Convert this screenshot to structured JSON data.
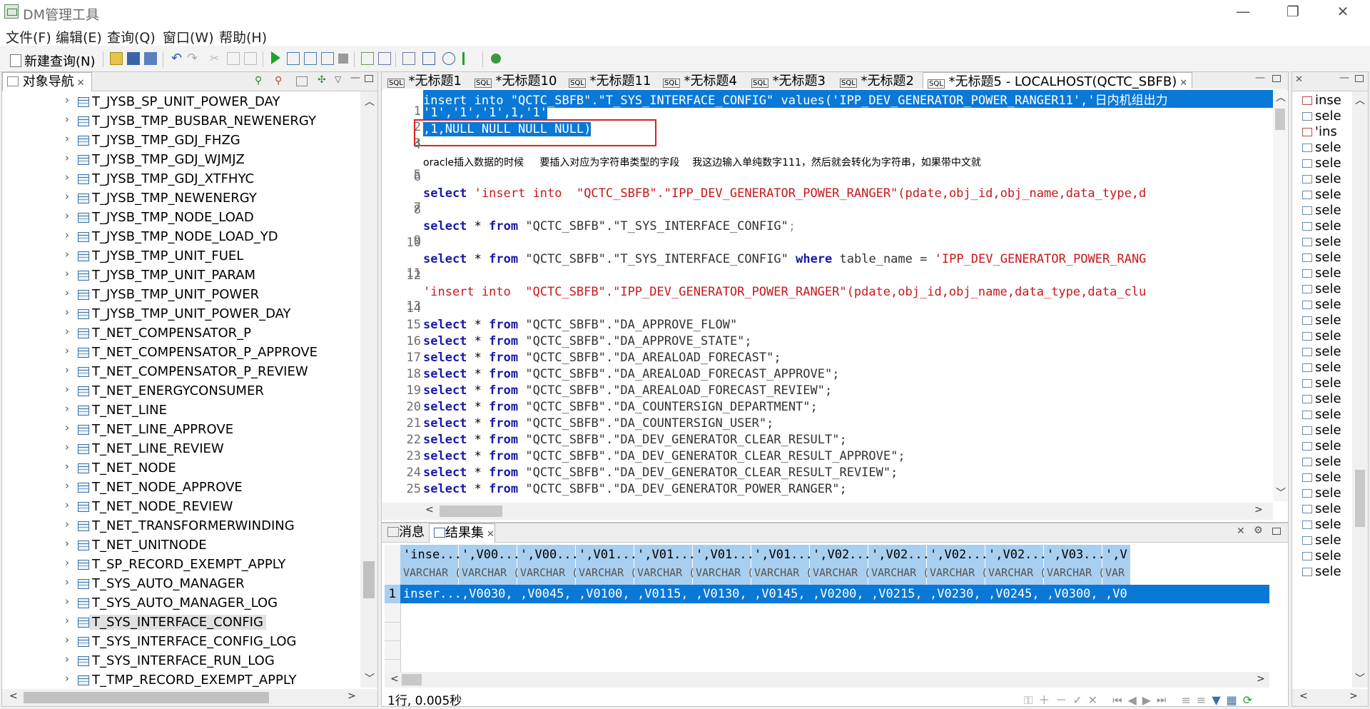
{
  "window": {
    "title": "DM管理工具",
    "minimize": "—",
    "restore": "❐",
    "close": "✕"
  },
  "menu": [
    "文件(F)",
    "编辑(E)",
    "查询(Q)",
    "窗口(W)",
    "帮助(H)"
  ],
  "toolbar": {
    "new_query": "新建查询(N)"
  },
  "navigator": {
    "title": "对象导航",
    "items": [
      "T_JYSB_SP_UNIT_POWER_DAY",
      "T_JYSB_TMP_BUSBAR_NEWENERGY",
      "T_JYSB_TMP_GDJ_FHZG",
      "T_JYSB_TMP_GDJ_WJMJZ",
      "T_JYSB_TMP_GDJ_XTFHYC",
      "T_JYSB_TMP_NEWENERGY",
      "T_JYSB_TMP_NODE_LOAD",
      "T_JYSB_TMP_NODE_LOAD_YD",
      "T_JYSB_TMP_UNIT_FUEL",
      "T_JYSB_TMP_UNIT_PARAM",
      "T_JYSB_TMP_UNIT_POWER",
      "T_JYSB_TMP_UNIT_POWER_DAY",
      "T_NET_COMPENSATOR_P",
      "T_NET_COMPENSATOR_P_APPROVE",
      "T_NET_COMPENSATOR_P_REVIEW",
      "T_NET_ENERGYCONSUMER",
      "T_NET_LINE",
      "T_NET_LINE_APPROVE",
      "T_NET_LINE_REVIEW",
      "T_NET_NODE",
      "T_NET_NODE_APPROVE",
      "T_NET_NODE_REVIEW",
      "T_NET_TRANSFORMERWINDING",
      "T_NET_UNITNODE",
      "T_SP_RECORD_EXEMPT_APPLY",
      "T_SYS_AUTO_MANAGER",
      "T_SYS_AUTO_MANAGER_LOG",
      "T_SYS_INTERFACE_CONFIG",
      "T_SYS_INTERFACE_CONFIG_LOG",
      "T_SYS_INTERFACE_RUN_LOG",
      "T_TMP_RECORD_EXEMPT_APPLY"
    ],
    "selected": "T_SYS_INTERFACE_CONFIG"
  },
  "editor_tabs": [
    "*无标题1",
    "*无标题10",
    "*无标题11",
    "*无标题4",
    "*无标题3",
    "*无标题2",
    "*无标题5 - LOCALHOST(QCTC_SBFB)"
  ],
  "active_editor_tab": "*无标题5 - LOCALHOST(QCTC_SBFB)",
  "code": {
    "line1": "insert into \"QCTC_SBFB\".\"T_SYS_INTERFACE_CONFIG\" values('IPP_DEV_GENERATOR_POWER_RANGER11','日内机组出力",
    "line2": "'1','1','1',1,'1'",
    "line3": ",1,NULL NULL NULL NULL)",
    "line5": "oracle插入数据的时候     要插入对应为字符串类型的字段    我这边输入单纯数字111，然后就会转化为字符串，如果带中文就",
    "line7_kw": "select",
    "line7_str": "'insert into  \"QCTC_SBFB\".\"IPP_DEV_GENERATOR_POWER_RANGER\"(pdate,obj_id,obj_name,data_type,d",
    "line9_tail": "\"QCTC_SBFB\".\"T_SYS_INTERFACE_CONFIG\"",
    "line11_mid": "\"QCTC_SBFB\".\"T_SYS_INTERFACE_CONFIG\"",
    "line11_where": "where",
    "line11_cond": "table_name =",
    "line11_str": "'IPP_DEV_GENERATOR_POWER_RANG",
    "line13": "'insert into  \"QCTC_SBFB\".\"IPP_DEV_GENERATOR_POWER_RANGER\"(pdate,obj_id,obj_name,data_type,data_clu",
    "select_tables": [
      "\"QCTC_SBFB\".\"DA_APPROVE_FLOW\"",
      "\"QCTC_SBFB\".\"DA_APPROVE_STATE\";",
      "\"QCTC_SBFB\".\"DA_AREALOAD_FORECAST\";",
      "\"QCTC_SBFB\".\"DA_AREALOAD_FORECAST_APPROVE\";",
      "\"QCTC_SBFB\".\"DA_AREALOAD_FORECAST_REVIEW\";",
      "\"QCTC_SBFB\".\"DA_COUNTERSIGN_DEPARTMENT\";",
      "\"QCTC_SBFB\".\"DA_COUNTERSIGN_USER\";",
      "\"QCTC_SBFB\".\"DA_DEV_GENERATOR_CLEAR_RESULT\";",
      "\"QCTC_SBFB\".\"DA_DEV_GENERATOR_CLEAR_RESULT_APPROVE\";",
      "\"QCTC_SBFB\".\"DA_DEV_GENERATOR_CLEAR_RESULT_REVIEW\";",
      "\"QCTC_SBFB\".\"DA_DEV_GENERATOR_POWER_RANGER\";"
    ],
    "kw_select": "select",
    "kw_from": "from",
    "star": "*",
    "semicolon": ";"
  },
  "results": {
    "tabs": [
      "消息",
      "结果集"
    ],
    "columns": [
      "'inse...",
      "',V00...",
      "',V00...",
      "',V01...",
      "',V01...",
      "',V01...",
      "',V01...",
      "',V02...",
      "',V02...",
      "',V02...",
      "',V02...",
      "',V03...",
      "',V"
    ],
    "types": [
      "VARCHAR (",
      "VARCHAR (",
      "VARCHAR (",
      "VARCHAR (",
      "VARCHAR (",
      "VARCHAR (",
      "VARCHAR (",
      "VARCHAR (",
      "VARCHAR (",
      "VARCHAR (",
      "VARCHAR (",
      "VARCHAR (",
      "VAR"
    ],
    "row1": [
      "inser...",
      ",V0030,",
      ",V0045,",
      ",V0100,",
      ",V0115,",
      ",V0130,",
      ",V0145,",
      ",V0200,",
      ",V0215,",
      ",V0230,",
      ",V0245,",
      ",V0300,",
      ",V0"
    ],
    "row_number": "1"
  },
  "status": {
    "text": "1行, 0.005秒"
  },
  "history": {
    "items": [
      "inse",
      "sele",
      "'ins",
      "sele",
      "sele",
      "sele",
      "sele",
      "sele",
      "sele",
      "sele",
      "sele",
      "sele",
      "sele",
      "sele",
      "sele",
      "sele",
      "sele",
      "sele",
      "sele",
      "sele",
      "sele",
      "sele",
      "sele",
      "sele",
      "sele",
      "sele",
      "sele",
      "sele",
      "sele",
      "sele",
      "sele"
    ]
  },
  "colors": {
    "selection": "#0a78d7",
    "grid_header": "#a8cff0",
    "keyword": "#1a1aa6",
    "string": "#c8181c",
    "highlight_box": "#e02020"
  }
}
